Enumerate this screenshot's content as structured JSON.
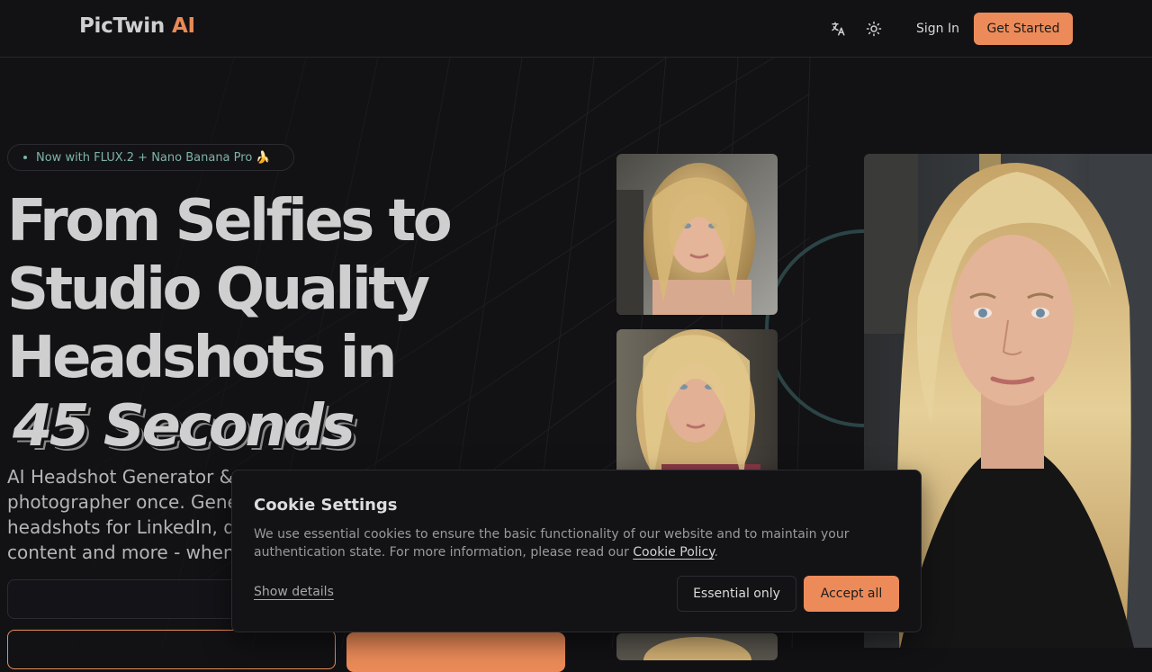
{
  "header": {
    "brand_name": "PicTwin",
    "brand_suffix": "AI",
    "translate_icon": "translate-icon",
    "theme_icon": "sun-icon",
    "sign_in_label": "Sign In",
    "get_started_label": "Get Started"
  },
  "hero": {
    "badge_text": "Now with FLUX.2 + Nano Banana Pro 🍌",
    "headline_lines": [
      "From Selfies to",
      "Studio Quality",
      "Headshots in"
    ],
    "headline_emphasis": "45 Seconds",
    "subtext_lines": [
      "AI Headshot Generator & P",
      "photographer once. Gene",
      "headshots for LinkedIn, da",
      "content and more - when"
    ]
  },
  "cookie": {
    "title": "Cookie Settings",
    "body": "We use essential cookies to ensure the basic functionality of our website and to maintain your authentication state. For more information, please read our",
    "policy_link": "Cookie Policy",
    "period": ".",
    "show_details_label": "Show details",
    "essential_label": "Essential only",
    "accept_label": "Accept all"
  },
  "colors": {
    "accent": "#ec8b59",
    "badge_text": "#7eb3a9",
    "background": "#121215"
  }
}
